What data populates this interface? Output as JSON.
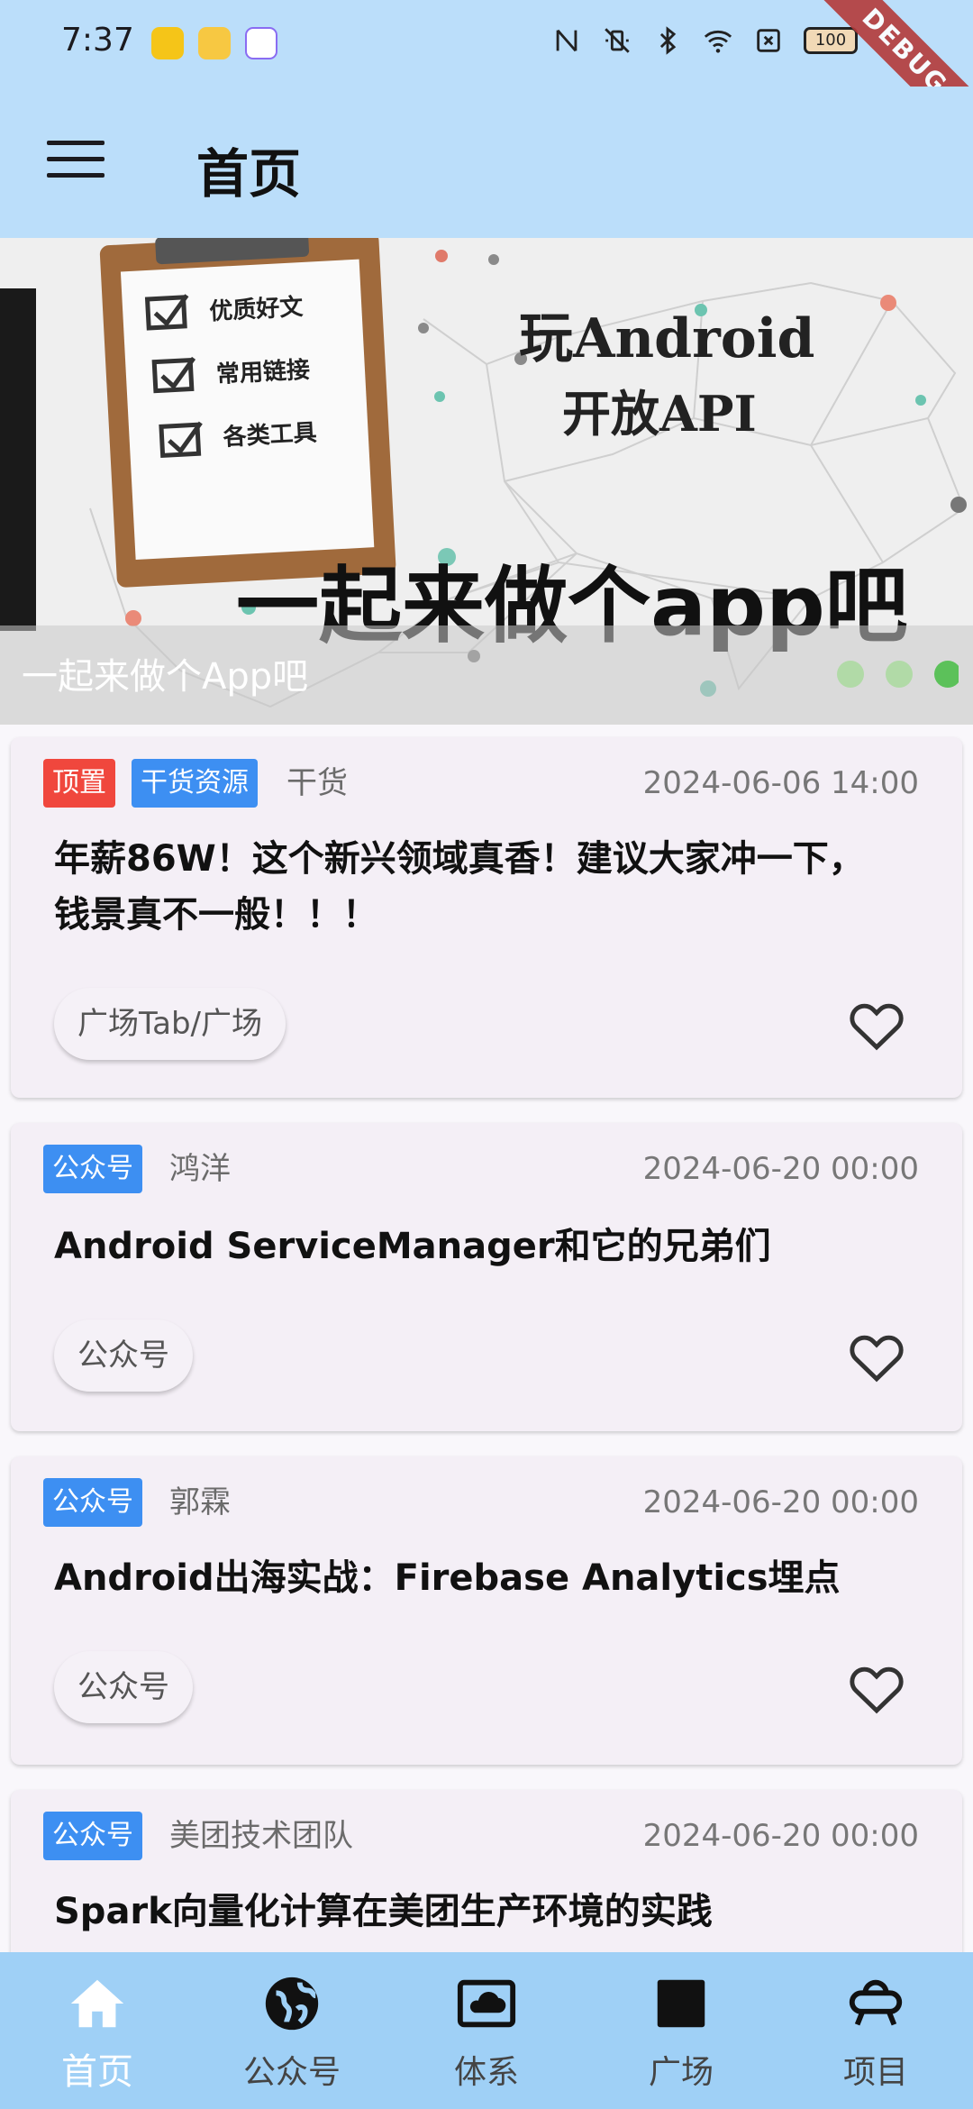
{
  "status_bar": {
    "time": "7:37",
    "battery": "100",
    "debug_label": "DEBUG"
  },
  "app_bar": {
    "title": "首页"
  },
  "banner": {
    "caption": "一起来做个App吧",
    "image_texts": {
      "check1": "优质好文",
      "check2": "常用链接",
      "check3": "各类工具",
      "headline1": "玩Android",
      "headline2": "开放API",
      "slogan": "一起来做个app吧"
    }
  },
  "articles": [
    {
      "tags": [
        "顶置",
        "干货资源"
      ],
      "author": "干货",
      "date": "2024-06-06 14:00",
      "title_line1": "年薪86W！这个新兴领域真香！建议大家冲一下，",
      "title_line2": "钱景真不一般！！！",
      "chip": "广场Tab/广场"
    },
    {
      "tags": [
        "公众号"
      ],
      "author": "鸿洋",
      "date": "2024-06-20 00:00",
      "title": "Android ServiceManager和它的兄弟们",
      "chip": "公众号"
    },
    {
      "tags": [
        "公众号"
      ],
      "author": "郭霖",
      "date": "2024-06-20 00:00",
      "title": "Android出海实战：Firebase Analytics埋点",
      "chip": "公众号"
    },
    {
      "tags": [
        "公众号"
      ],
      "author": "美团技术团队",
      "date": "2024-06-20 00:00",
      "title": "Spark向量化计算在美团生产环境的实践"
    }
  ],
  "bottom_nav": [
    {
      "label": "首页",
      "icon": "home-icon",
      "active": true
    },
    {
      "label": "公众号",
      "icon": "globe-icon"
    },
    {
      "label": "体系",
      "icon": "cloud-screen-icon"
    },
    {
      "label": "广场",
      "icon": "square-icon"
    },
    {
      "label": "项目",
      "icon": "ufo-icon"
    }
  ],
  "colors": {
    "app_bar": "#bbdefa",
    "bottom_nav": "#9fd0f6",
    "tag_red": "#f0473d",
    "tag_blue": "#3d8ff2"
  }
}
